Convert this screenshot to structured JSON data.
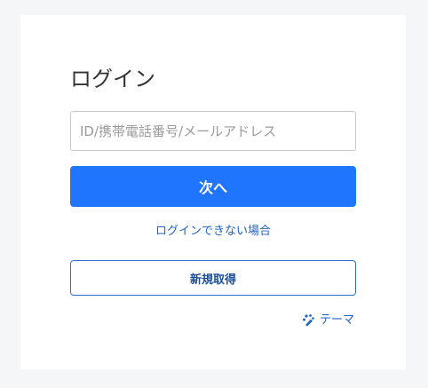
{
  "login": {
    "title": "ログイン",
    "id_placeholder": "ID/携帯電話番号/メールアドレス",
    "id_value": "",
    "next_label": "次へ",
    "trouble_label": "ログインできない場合",
    "register_label": "新規取得",
    "theme_label": "テーマ",
    "theme_icon": "palette-icon"
  },
  "colors": {
    "background": "#f5f6f8",
    "card": "#ffffff",
    "primary": "#1f75fe",
    "link": "#1f63c6",
    "border": "#c8c8c8"
  }
}
